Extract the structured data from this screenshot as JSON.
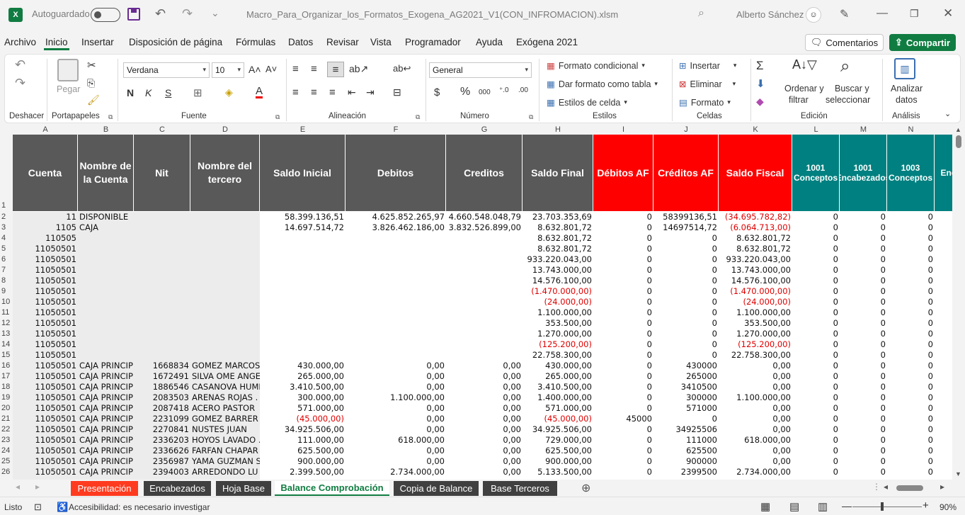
{
  "title": {
    "autosave_label": "Autoguardado",
    "filename": "Macro_Para_Organizar_los_Formatos_Exogena_AG2021_V1(CON_INFROMACION).xlsm",
    "user": "Alberto Sánchez",
    "app_logo": "X"
  },
  "menu": [
    "Archivo",
    "Inicio",
    "Insertar",
    "Disposición de página",
    "Fórmulas",
    "Datos",
    "Revisar",
    "Vista",
    "Programador",
    "Ayuda",
    "Exógena 2021"
  ],
  "comments_label": "Comentarios",
  "share_label": "Compartir",
  "ribbon": {
    "undo_group": "Deshacer",
    "clipboard_group": "Portapapeles",
    "paste_label": "Pegar",
    "font_group": "Fuente",
    "font_name": "Verdana",
    "font_size": "10",
    "bold": "N",
    "italic": "K",
    "underline": "S",
    "align_group": "Alineación",
    "number_group": "Número",
    "number_format": "General",
    "currency": "$",
    "percent": "%",
    "thousands": "000",
    "styles_group": "Estilos",
    "cond_format": "Formato condicional",
    "table_format": "Dar formato como tabla",
    "cell_styles": "Estilos de celda",
    "cells_group": "Celdas",
    "insert": "Insertar",
    "delete": "Eliminar",
    "format": "Formato",
    "edit_group": "Edición",
    "sort_filter_1": "Ordenar y",
    "sort_filter_2": "filtrar",
    "find_select_1": "Buscar y",
    "find_select_2": "seleccionar",
    "analysis_group": "Análisis",
    "analyze_1": "Analizar",
    "analyze_2": "datos"
  },
  "columns": [
    "A",
    "B",
    "C",
    "D",
    "E",
    "F",
    "G",
    "H",
    "I",
    "J",
    "K",
    "L",
    "M",
    "N"
  ],
  "headers": [
    {
      "text": "Cuenta",
      "color": "gray"
    },
    {
      "text": "Nombre de la Cuenta",
      "color": "gray"
    },
    {
      "text": "Nit",
      "color": "gray"
    },
    {
      "text": "Nombre del tercero",
      "color": "gray"
    },
    {
      "text": "Saldo Inicial",
      "color": "gray"
    },
    {
      "text": "Debitos",
      "color": "gray"
    },
    {
      "text": "Creditos",
      "color": "gray"
    },
    {
      "text": "Saldo Final",
      "color": "gray"
    },
    {
      "text": "Débitos AF",
      "color": "red"
    },
    {
      "text": "Créditos AF",
      "color": "red"
    },
    {
      "text": "Saldo Fiscal",
      "color": "red"
    },
    {
      "text": "1001 Conceptos",
      "color": "teal"
    },
    {
      "text": "1001 Encabezados",
      "color": "teal"
    },
    {
      "text": "1003 Conceptos",
      "color": "teal"
    },
    {
      "text": "Enc",
      "color": "teal"
    }
  ],
  "row_numbers": [
    "1",
    "2",
    "3",
    "4",
    "5",
    "6",
    "7",
    "8",
    "9",
    "10",
    "11",
    "12",
    "13",
    "14",
    "15",
    "16",
    "17",
    "18",
    "19",
    "20",
    "21",
    "22",
    "23",
    "24",
    "25",
    "26"
  ],
  "rows": [
    [
      "11",
      "DISPONIBLE",
      "",
      "",
      "58.399.136,51",
      "4.625.852.265,97",
      "4.660.548.048,79",
      "23.703.353,69",
      "0",
      "58399136,51",
      "(34.695.782,82)",
      "0",
      "0",
      "0"
    ],
    [
      "1105",
      "CAJA",
      "",
      "",
      "14.697.514,72",
      "3.826.462.186,00",
      "3.832.526.899,00",
      "8.632.801,72",
      "0",
      "14697514,72",
      "(6.064.713,00)",
      "0",
      "0",
      "0"
    ],
    [
      "110505",
      "",
      "",
      "",
      "",
      "",
      "",
      "8.632.801,72",
      "0",
      "0",
      "8.632.801,72",
      "0",
      "0",
      "0"
    ],
    [
      "11050501",
      "",
      "",
      "",
      "",
      "",
      "",
      "8.632.801,72",
      "0",
      "0",
      "8.632.801,72",
      "0",
      "0",
      "0"
    ],
    [
      "11050501",
      "",
      "",
      "",
      "",
      "",
      "",
      "933.220.043,00",
      "0",
      "0",
      "933.220.043,00",
      "0",
      "0",
      "0"
    ],
    [
      "11050501",
      "",
      "",
      "",
      "",
      "",
      "",
      "13.743.000,00",
      "0",
      "0",
      "13.743.000,00",
      "0",
      "0",
      "0"
    ],
    [
      "11050501",
      "",
      "",
      "",
      "",
      "",
      "",
      "14.576.100,00",
      "0",
      "0",
      "14.576.100,00",
      "0",
      "0",
      "0"
    ],
    [
      "11050501",
      "",
      "",
      "",
      "",
      "",
      "",
      "(1.470.000,00)",
      "0",
      "0",
      "(1.470.000,00)",
      "0",
      "0",
      "0"
    ],
    [
      "11050501",
      "",
      "",
      "",
      "",
      "",
      "",
      "(24.000,00)",
      "0",
      "0",
      "(24.000,00)",
      "0",
      "0",
      "0"
    ],
    [
      "11050501",
      "",
      "",
      "",
      "",
      "",
      "",
      "1.100.000,00",
      "0",
      "0",
      "1.100.000,00",
      "0",
      "0",
      "0"
    ],
    [
      "11050501",
      "",
      "",
      "",
      "",
      "",
      "",
      "353.500,00",
      "0",
      "0",
      "353.500,00",
      "0",
      "0",
      "0"
    ],
    [
      "11050501",
      "",
      "",
      "",
      "",
      "",
      "",
      "1.270.000,00",
      "0",
      "0",
      "1.270.000,00",
      "0",
      "0",
      "0"
    ],
    [
      "11050501",
      "",
      "",
      "",
      "",
      "",
      "",
      "(125.200,00)",
      "0",
      "0",
      "(125.200,00)",
      "0",
      "0",
      "0"
    ],
    [
      "11050501",
      "",
      "",
      "",
      "",
      "",
      "",
      "22.758.300,00",
      "0",
      "0",
      "22.758.300,00",
      "0",
      "0",
      "0"
    ],
    [
      "11050501",
      "CAJA PRINCIP",
      "1668834",
      "GOMEZ MARCOS",
      "430.000,00",
      "0,00",
      "0,00",
      "430.000,00",
      "0",
      "430000",
      "0,00",
      "0",
      "0",
      "0"
    ],
    [
      "11050501",
      "CAJA PRINCIP",
      "1672491",
      "SILVA OME ANGE",
      "265.000,00",
      "0,00",
      "0,00",
      "265.000,00",
      "0",
      "265000",
      "0,00",
      "0",
      "0",
      "0"
    ],
    [
      "11050501",
      "CAJA PRINCIP",
      "1886546",
      "CASANOVA HUMI",
      "3.410.500,00",
      "0,00",
      "0,00",
      "3.410.500,00",
      "0",
      "3410500",
      "0,00",
      "0",
      "0",
      "0"
    ],
    [
      "11050501",
      "CAJA PRINCIP",
      "2083503",
      "ARENAS ROJAS .",
      "300.000,00",
      "1.100.000,00",
      "0,00",
      "1.400.000,00",
      "0",
      "300000",
      "1.100.000,00",
      "0",
      "0",
      "0"
    ],
    [
      "11050501",
      "CAJA PRINCIP",
      "2087418",
      "ACERO PASTOR",
      "571.000,00",
      "0,00",
      "0,00",
      "571.000,00",
      "0",
      "571000",
      "0,00",
      "0",
      "0",
      "0"
    ],
    [
      "11050501",
      "CAJA PRINCIP",
      "2231099",
      "GOMEZ BARRER",
      "(45.000,00)",
      "0,00",
      "0,00",
      "(45.000,00)",
      "45000",
      "0",
      "0,00",
      "0",
      "0",
      "0"
    ],
    [
      "11050501",
      "CAJA PRINCIP",
      "2270841",
      "NUSTES JUAN",
      "34.925.506,00",
      "0,00",
      "0,00",
      "34.925.506,00",
      "0",
      "34925506",
      "0,00",
      "0",
      "0",
      "0"
    ],
    [
      "11050501",
      "CAJA PRINCIP",
      "2336203",
      "HOYOS LAVADO .",
      "111.000,00",
      "618.000,00",
      "0,00",
      "729.000,00",
      "0",
      "111000",
      "618.000,00",
      "0",
      "0",
      "0"
    ],
    [
      "11050501",
      "CAJA PRINCIP",
      "2336626",
      "FARFAN CHAPAR",
      "625.500,00",
      "0,00",
      "0,00",
      "625.500,00",
      "0",
      "625500",
      "0,00",
      "0",
      "0",
      "0"
    ],
    [
      "11050501",
      "CAJA PRINCIP",
      "2356987",
      "YAMA GUZMAN S",
      "900.000,00",
      "0,00",
      "0,00",
      "900.000,00",
      "0",
      "900000",
      "0,00",
      "0",
      "0",
      "0"
    ],
    [
      "11050501",
      "CAJA PRINCIP",
      "2394003",
      "ARREDONDO LU",
      "2.399.500,00",
      "2.734.000,00",
      "0,00",
      "5.133.500,00",
      "0",
      "2399500",
      "2.734.000,00",
      "0",
      "0",
      "0"
    ]
  ],
  "sheets": [
    {
      "label": "Presentación",
      "style": "t-red"
    },
    {
      "label": "Encabezados",
      "style": "t-dark"
    },
    {
      "label": "Hoja Base",
      "style": "t-dark"
    },
    {
      "label": "Balance Comprobación",
      "style": "t-active"
    },
    {
      "label": "Copia de Balance",
      "style": "t-dark"
    },
    {
      "label": "Base Terceros",
      "style": "t-dark"
    }
  ],
  "status": {
    "ready": "Listo",
    "accessibility": "Accesibilidad: es necesario investigar",
    "zoom": "90%"
  }
}
